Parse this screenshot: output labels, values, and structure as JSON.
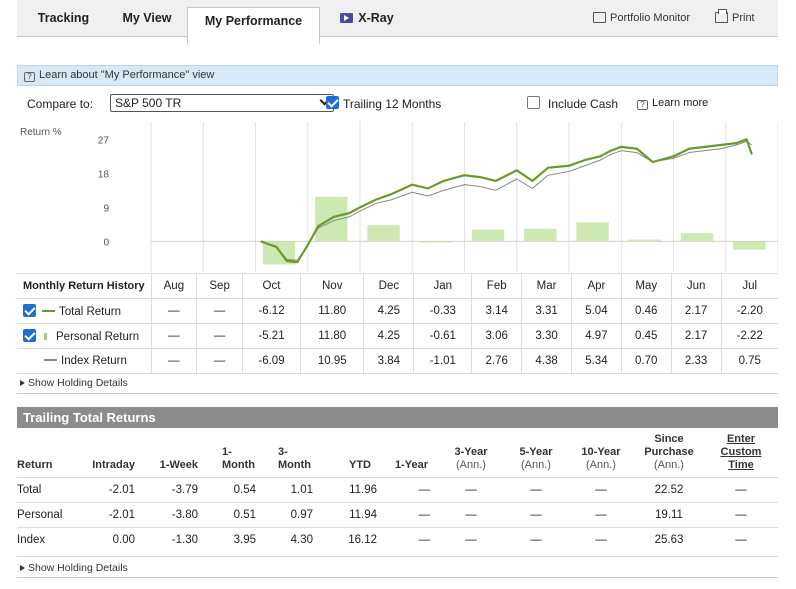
{
  "tabs": [
    {
      "label": "Tracking",
      "active": false
    },
    {
      "label": "My View",
      "active": false
    },
    {
      "label": "My Performance",
      "active": true
    },
    {
      "label": "X-Ray",
      "active": false
    }
  ],
  "tools": {
    "portfolio_monitor": "Portfolio Monitor",
    "print": "Print"
  },
  "learn": {
    "text": "Learn about \"My Performance\" view"
  },
  "controls": {
    "compare_label": "Compare to:",
    "compare_value": "S&P 500 TR",
    "trailing_label": "Trailing 12 Months",
    "trailing_checked": true,
    "cash_label": "Include Cash",
    "cash_checked": false,
    "learn_more": "Learn more"
  },
  "colors": {
    "total": "#6a9a2a",
    "personal": "#a6cc70",
    "index": "#888888",
    "bar": "#c6e4a6"
  },
  "chart_data": {
    "type": "line",
    "ylabel": "Return %",
    "yticks": [
      "27",
      "18",
      "9",
      "0"
    ],
    "ylim": [
      -6,
      30
    ],
    "months": [
      "Aug",
      "Sep",
      "Oct",
      "Nov",
      "Dec",
      "Jan",
      "Feb",
      "Mar",
      "Apr",
      "May",
      "Jun",
      "Jul"
    ],
    "monthly_bars": [
      null,
      null,
      -6.12,
      11.8,
      4.25,
      -0.33,
      3.14,
      3.31,
      5.04,
      0.46,
      2.17,
      -2.2
    ],
    "series": [
      {
        "name": "Total Return",
        "x": [
          2.1,
          2.4,
          2.6,
          2.8,
          3.0,
          3.2,
          3.5,
          3.8,
          4.0,
          4.3,
          4.6,
          5.0,
          5.3,
          5.6,
          6.0,
          6.3,
          6.6,
          7.0,
          7.3,
          7.6,
          8.0,
          8.3,
          8.6,
          8.8,
          9.0,
          9.3,
          9.6,
          10.0,
          10.3,
          10.6,
          10.9,
          11.2,
          11.4,
          11.5
        ],
        "y": [
          0,
          -1.5,
          -5.2,
          -5.5,
          -1,
          4,
          6.5,
          7.5,
          9,
          11,
          12.5,
          15,
          14,
          16,
          17.5,
          17,
          16,
          18.8,
          16,
          19.5,
          20,
          21.5,
          22.5,
          24,
          25,
          24.5,
          21,
          22.5,
          24.5,
          25,
          25.5,
          26,
          27,
          23
        ]
      },
      {
        "name": "Index Return",
        "x": [
          2.1,
          2.4,
          2.6,
          2.8,
          3.0,
          3.2,
          3.5,
          3.8,
          4.0,
          4.3,
          4.6,
          5.0,
          5.3,
          5.6,
          6.0,
          6.3,
          6.6,
          7.0,
          7.3,
          7.6,
          8.0,
          8.3,
          8.6,
          8.8,
          9.0,
          9.3,
          9.6,
          10.0,
          10.3,
          10.6,
          10.9,
          11.2,
          11.4,
          11.5
        ],
        "y": [
          0,
          -1.3,
          -4.8,
          -5,
          -1,
          3.5,
          5.5,
          6.5,
          8,
          10,
          11,
          13,
          12,
          13.5,
          15,
          14.5,
          13.5,
          16.5,
          14,
          17.5,
          18.5,
          20,
          21.5,
          23,
          24,
          23.5,
          21,
          22,
          23.5,
          24,
          24.5,
          25.5,
          26.5,
          25.5
        ]
      }
    ]
  },
  "monthly": {
    "header": "Monthly Return History",
    "months": [
      "Aug",
      "Sep",
      "Oct",
      "Nov",
      "Dec",
      "Jan",
      "Feb",
      "Mar",
      "Apr",
      "May",
      "Jun",
      "Jul"
    ],
    "rows": [
      {
        "label": "Total Return",
        "checked": true,
        "values": [
          "—",
          "—",
          "-6.12",
          "11.80",
          "4.25",
          "-0.33",
          "3.14",
          "3.31",
          "5.04",
          "0.46",
          "2.17",
          "-2.20"
        ]
      },
      {
        "label": "Personal Return",
        "checked": true,
        "values": [
          "—",
          "—",
          "-5.21",
          "11.80",
          "4.25",
          "-0.61",
          "3.06",
          "3.30",
          "4.97",
          "0.45",
          "2.17",
          "-2.22"
        ]
      },
      {
        "label": "Index Return",
        "checked": null,
        "values": [
          "—",
          "—",
          "-6.09",
          "10.95",
          "3.84",
          "-1.01",
          "2.76",
          "4.38",
          "5.34",
          "0.70",
          "2.33",
          "0.75"
        ]
      }
    ]
  },
  "holding_details": "Show Holding Details",
  "trailing": {
    "title": "Trailing Total Returns",
    "columns": [
      {
        "l1": "",
        "l2": "",
        "l3": "Return"
      },
      {
        "l1": "",
        "l2": "",
        "l3": "Intraday"
      },
      {
        "l1": "",
        "l2": "",
        "l3": "1-Week"
      },
      {
        "l1": "",
        "l2": "1-",
        "l3": "Month"
      },
      {
        "l1": "",
        "l2": "3-",
        "l3": "Month"
      },
      {
        "l1": "",
        "l2": "",
        "l3": "YTD"
      },
      {
        "l1": "",
        "l2": "",
        "l3": "1-Year"
      },
      {
        "l1": "",
        "l2": "3-Year",
        "l3": "(Ann.)"
      },
      {
        "l1": "",
        "l2": "5-Year",
        "l3": "(Ann.)"
      },
      {
        "l1": "",
        "l2": "10-Year",
        "l3": "(Ann.)"
      },
      {
        "l1": "Since",
        "l2": "Purchase",
        "l3": "(Ann.)"
      },
      {
        "l1": "Enter",
        "l2": "Custom",
        "l3": "Time"
      }
    ],
    "rows": [
      {
        "label": "Total",
        "values": [
          "-2.01",
          "-3.79",
          "0.54",
          "1.01",
          "11.96",
          "—",
          "—",
          "—",
          "—",
          "22.52",
          "—"
        ]
      },
      {
        "label": "Personal",
        "values": [
          "-2.01",
          "-3.80",
          "0.51",
          "0.97",
          "11.94",
          "—",
          "—",
          "—",
          "—",
          "19.11",
          "—"
        ]
      },
      {
        "label": "Index",
        "values": [
          "0.00",
          "-1.30",
          "3.95",
          "4.30",
          "16.12",
          "—",
          "—",
          "—",
          "—",
          "25.63",
          "—"
        ]
      }
    ]
  }
}
